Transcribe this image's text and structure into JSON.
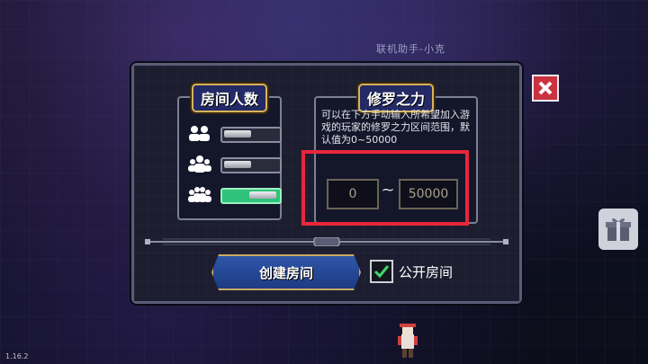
{
  "background": {
    "helper_label": "联机助手-小克",
    "version": "1.16.2"
  },
  "dialog": {
    "room_size": {
      "title": "房间人数",
      "options": [
        {
          "icon": "two-players-icon",
          "state": "off"
        },
        {
          "icon": "three-players-icon",
          "state": "off"
        },
        {
          "icon": "four-players-icon",
          "state": "on"
        }
      ]
    },
    "power": {
      "title": "修罗之力",
      "description": "可以在下方手动输入所希望加入游戏的玩家的修罗之力区间范围，默认值为0~50000",
      "min_value": "0",
      "separator": "~",
      "max_value": "50000"
    },
    "create_button": "创建房间",
    "public_checkbox": {
      "label": "公开房间",
      "checked": true
    }
  },
  "colors": {
    "accent_highlight": "#e8263c",
    "toggle_on": "#2fc27a",
    "button_blue": "#2f56a8"
  }
}
